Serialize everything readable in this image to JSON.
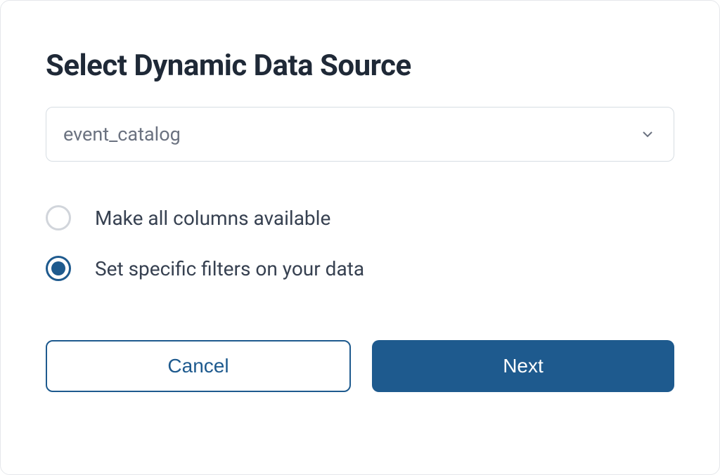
{
  "dialog": {
    "title": "Select Dynamic Data Source",
    "select": {
      "value": "event_catalog"
    },
    "radios": {
      "option1": {
        "label": "Make all columns available",
        "selected": false
      },
      "option2": {
        "label": "Set specific filters on your data",
        "selected": true
      }
    },
    "buttons": {
      "cancel": "Cancel",
      "next": "Next"
    }
  }
}
